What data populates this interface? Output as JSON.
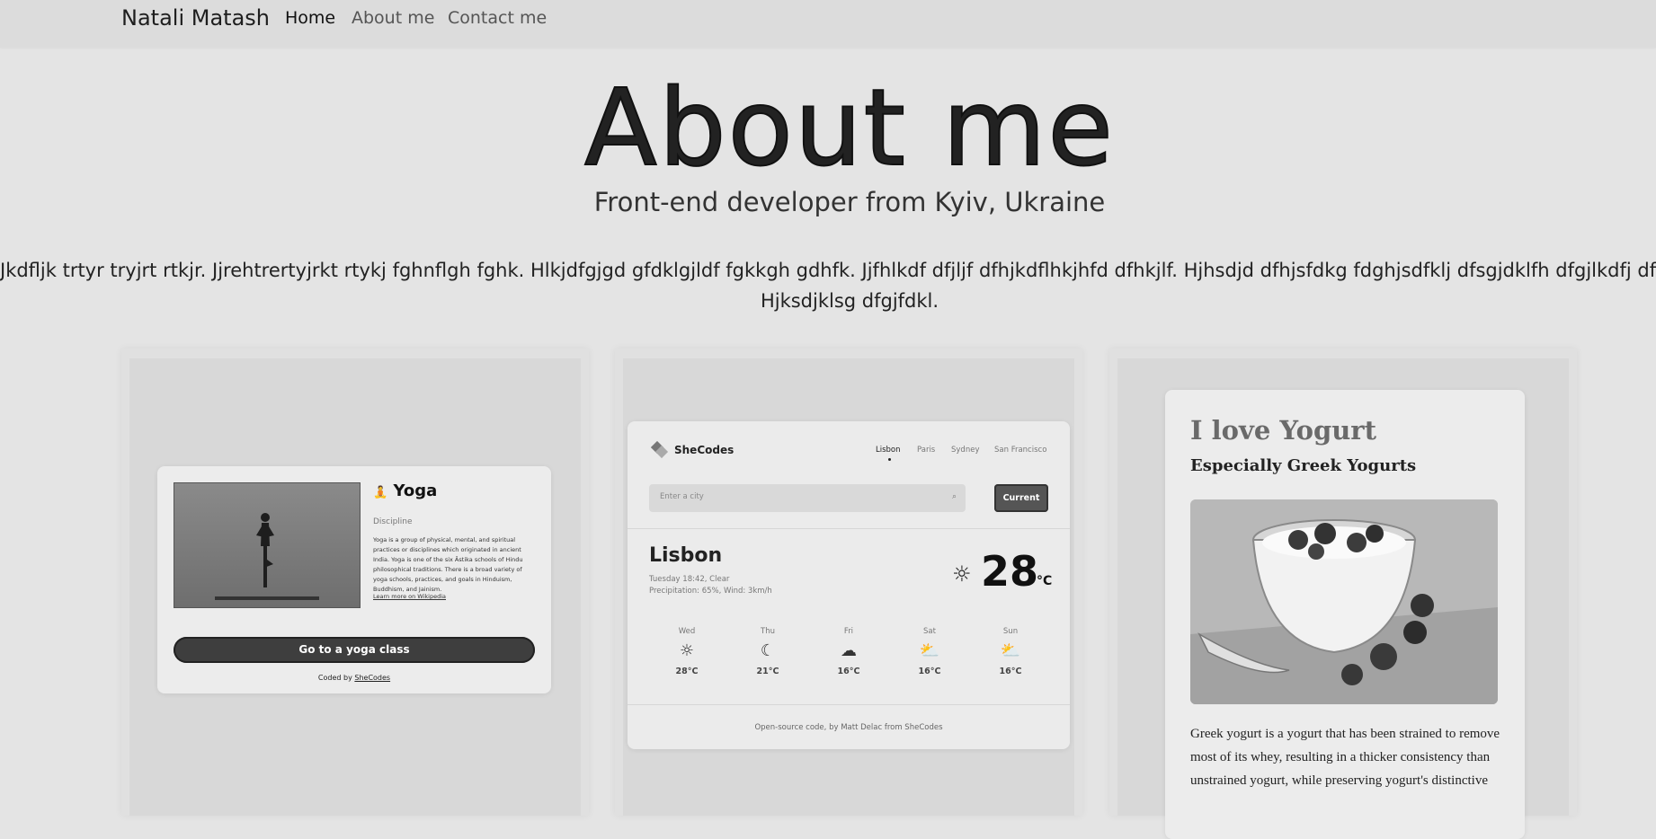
{
  "nav": {
    "brand": "Natali Matash",
    "links": [
      "Home",
      "About me",
      "Contact me"
    ]
  },
  "hero": {
    "title": "About me",
    "subtitle": "Front-end developer from Kyiv, Ukraine"
  },
  "intro": {
    "line1": "Jkdfljk trtyr tryjrt rtkjr. Jjrehtrertyjrkt rtykj fghnflgh fghk. Hlkjdfgjgd gfdklgjldf fgkkgh gdhfk. Jjfhlkdf dfjljf dfhjkdflhkjhfd dfhkjlf. Hjhsdjd dfhjsfdkg fdghjsdfklj dfsgjdklfh dfgjlkdfj dfgkldh",
    "line2": "Hjksdjklsg dfgjfdkl."
  },
  "projects": {
    "yoga": {
      "heading": "Yoga",
      "subheading": "Discipline",
      "body": "Yoga is a group of physical, mental, and spiritual practices or disciplines which originated in ancient India. Yoga is one of the six Āstika schools of Hindu philosophical traditions. There is a broad variety of yoga schools, practices, and goals in Hinduism, Buddhism, and Jainism.",
      "link": "Learn more on Wikipedia",
      "button": "Go to a yoga class",
      "credit_prefix": "Coded by",
      "credit_link": "SheCodes"
    },
    "weather": {
      "logo": "SheCodes",
      "cities": [
        "Lisbon",
        "Paris",
        "Sydney",
        "San Francisco"
      ],
      "search_placeholder": "Enter a city",
      "current_button": "Current",
      "city": "Lisbon",
      "details_line1": "Tuesday 18:42, Clear",
      "details_line2": "Precipitation: 65%, Wind: 3km/h",
      "temperature": "28",
      "unit": "°C",
      "forecast": [
        {
          "day": "Wed",
          "icon": "sun-icon",
          "temp": "28°C"
        },
        {
          "day": "Thu",
          "icon": "moon-icon",
          "temp": "21°C"
        },
        {
          "day": "Fri",
          "icon": "cloud-icon",
          "temp": "16°C"
        },
        {
          "day": "Sat",
          "icon": "cloud-sun-icon",
          "temp": "16°C"
        },
        {
          "day": "Sun",
          "icon": "sun-cloud-icon",
          "temp": "16°C"
        }
      ],
      "footer": "Open-source code, by Matt Delac from SheCodes"
    },
    "yogurt": {
      "title": "I love Yogurt",
      "subtitle": "Especially Greek Yogurts",
      "text": "Greek yogurt is a yogurt that has been strained to remove most of its whey, resulting in a thicker consistency than unstrained yogurt, while preserving yogurt's distinctive"
    }
  }
}
